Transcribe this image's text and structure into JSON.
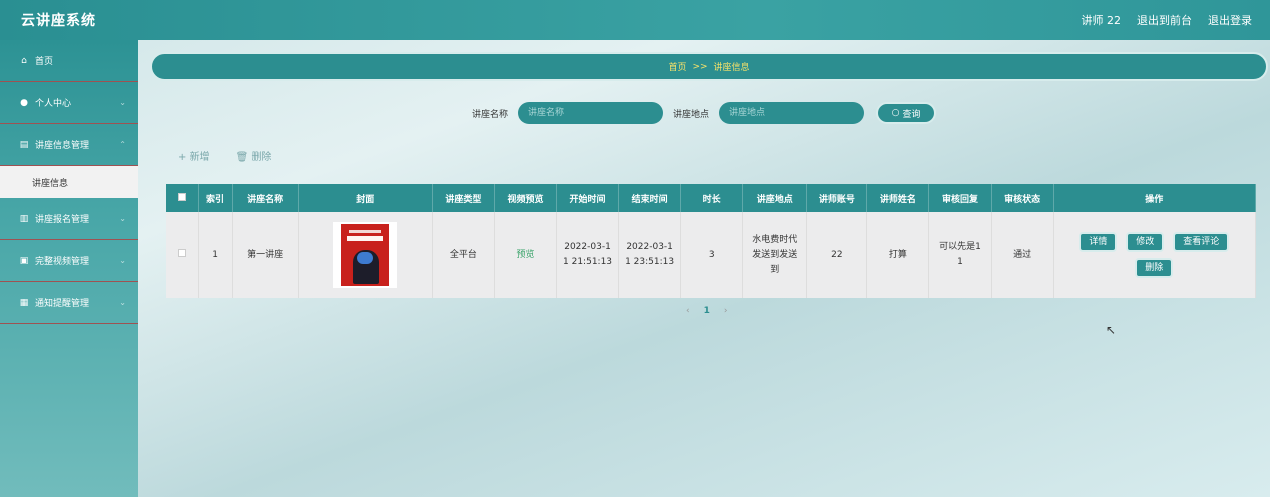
{
  "header": {
    "app_title": "云讲座系统",
    "user": "讲师 22",
    "to_front": "退出到前台",
    "logout": "退出登录"
  },
  "sidebar": {
    "items": [
      {
        "label": "首页",
        "icon": "home-icon"
      },
      {
        "label": "个人中心",
        "icon": "user-icon"
      },
      {
        "label": "讲座信息管理",
        "icon": "document-icon"
      },
      {
        "label": "讲座报名管理",
        "icon": "building-icon"
      },
      {
        "label": "完整视频管理",
        "icon": "clipboard-icon"
      },
      {
        "label": "通知提醒管理",
        "icon": "grid-icon"
      }
    ],
    "sub_item": "讲座信息"
  },
  "breadcrumb": {
    "home": "首页",
    "sep": ">>",
    "current": "讲座信息"
  },
  "search": {
    "name_label": "讲座名称",
    "name_placeholder": "讲座名称",
    "place_label": "讲座地点",
    "place_placeholder": "讲座地点",
    "button": "查询"
  },
  "actions": {
    "add": "新增",
    "delete": "删除"
  },
  "table": {
    "headers": [
      "",
      "索引",
      "讲座名称",
      "封面",
      "讲座类型",
      "视频预览",
      "开始时间",
      "结束时间",
      "时长",
      "讲座地点",
      "讲师账号",
      "讲师姓名",
      "审核回复",
      "审核状态",
      "操作"
    ],
    "rows": [
      {
        "index": "1",
        "name": "第一讲座",
        "type": "全平台",
        "preview": "预览",
        "start": "2022-03-1\n1 21:51:13",
        "end": "2022-03-1\n1 23:51:13",
        "duration": "3",
        "place": "水电费时代\n发送到发送\n到",
        "account": "22",
        "teacher": "打算",
        "reply": "可以先是1\n1",
        "status": "通过"
      }
    ],
    "ops": {
      "detail": "详情",
      "edit": "修改",
      "comments": "查看评论",
      "delete": "删除"
    }
  },
  "pager": {
    "prev": "‹",
    "page": "1",
    "next": "›"
  },
  "colors": {
    "primary": "#2c8e90",
    "breadcrumb_text": "#f7e36a"
  }
}
